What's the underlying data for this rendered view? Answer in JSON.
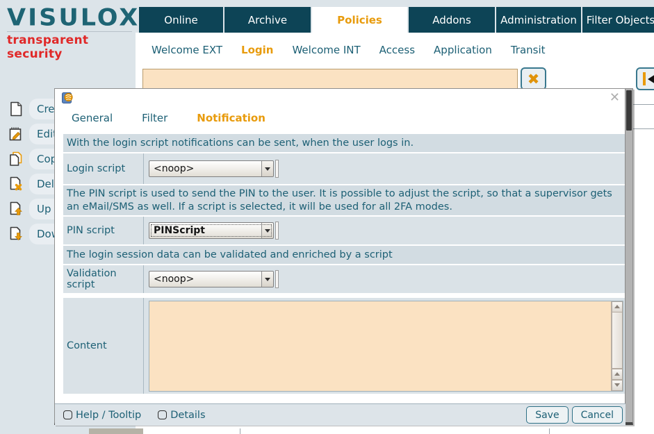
{
  "colors": {
    "accent_orange": "#e89b0c",
    "nav_teal": "#0d4456",
    "logo_teal": "#1e6474",
    "tagline_red": "#e02828",
    "text_teal": "#1d6075",
    "input_peach": "#fbe2c2"
  },
  "brand": {
    "name": "VISULOX",
    "tagline": "transparent security"
  },
  "main_nav": {
    "items": [
      {
        "label": "Online",
        "active": false
      },
      {
        "label": "Archive",
        "active": false
      },
      {
        "label": "Policies",
        "active": true
      },
      {
        "label": "Addons",
        "active": false
      },
      {
        "label": "Administration",
        "active": false
      },
      {
        "label": "Filter Objects",
        "active": false
      }
    ]
  },
  "sub_nav": {
    "items": [
      {
        "label": "Welcome EXT",
        "active": false
      },
      {
        "label": "Login",
        "active": true
      },
      {
        "label": "Welcome INT",
        "active": false
      },
      {
        "label": "Access",
        "active": false
      },
      {
        "label": "Application",
        "active": false
      },
      {
        "label": "Transit",
        "active": false
      }
    ]
  },
  "toolbar": {
    "search_value": "",
    "clear_icon": "✖"
  },
  "sidebar": {
    "items": [
      {
        "label": "Cre",
        "icon": "document-new-icon"
      },
      {
        "label": "Edit",
        "icon": "document-edit-icon"
      },
      {
        "label": "Cop",
        "icon": "document-copy-icon"
      },
      {
        "label": "Del",
        "icon": "document-delete-icon"
      },
      {
        "label": "Up",
        "icon": "document-upload-icon"
      },
      {
        "label": "Dow",
        "icon": "document-download-icon"
      }
    ]
  },
  "dialog": {
    "close_icon": "✕",
    "tabs": [
      {
        "label": "General",
        "active": false
      },
      {
        "label": "Filter",
        "active": false
      },
      {
        "label": "Notification",
        "active": true
      }
    ],
    "info_login": "With the login script notifications can be sent, when the user logs in.",
    "login_script": {
      "label": "Login script",
      "value": "<noop>"
    },
    "info_pin": "The PIN script is used to send the PIN to the user. It is possible to adjust the script, so that a supervisor gets an eMail/SMS as well. If a script is selected, it will be used for all 2FA modes.",
    "pin_script": {
      "label": "PIN script",
      "value": "PINScript"
    },
    "info_validation": "The login session data can be validated and enriched by a script",
    "validation_script": {
      "label": "Validation script",
      "value": "<noop>"
    },
    "content": {
      "label": "Content",
      "value": ""
    },
    "footer": {
      "help_checkbox": {
        "label": "Help / Tooltip",
        "checked": false
      },
      "details_checkbox": {
        "label": "Details",
        "checked": false
      },
      "save_label": "Save",
      "cancel_label": "Cancel"
    }
  }
}
